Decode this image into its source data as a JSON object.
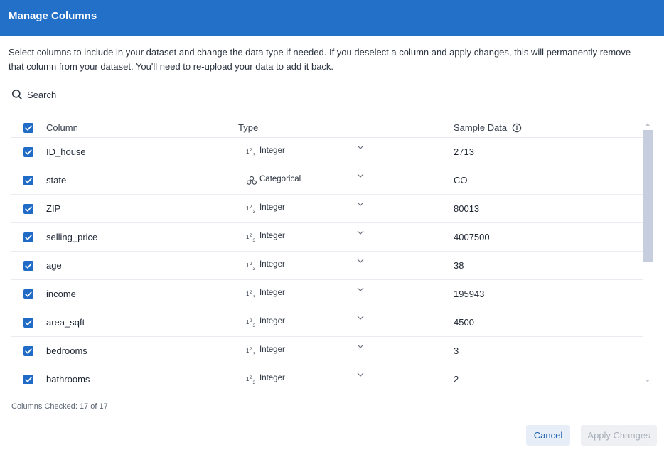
{
  "header": {
    "title": "Manage Columns"
  },
  "description": "Select columns to include in your dataset and change the data type if needed. If you deselect a column and apply changes, this will permanently remove that column from your dataset. You'll need to re-upload your data to add it back.",
  "search": {
    "label": "Search",
    "icon": "search-icon"
  },
  "table": {
    "headers": {
      "column": "Column",
      "type": "Type",
      "sample": "Sample Data"
    },
    "rows": [
      {
        "name": "ID_house",
        "type": "Integer",
        "type_icon": "integer",
        "sample": "2713",
        "checked": true
      },
      {
        "name": "state",
        "type": "Categorical",
        "type_icon": "categorical",
        "sample": "CO",
        "checked": true
      },
      {
        "name": "ZIP",
        "type": "Integer",
        "type_icon": "integer",
        "sample": "80013",
        "checked": true
      },
      {
        "name": "selling_price",
        "type": "Integer",
        "type_icon": "integer",
        "sample": "4007500",
        "checked": true
      },
      {
        "name": "age",
        "type": "Integer",
        "type_icon": "integer",
        "sample": "38",
        "checked": true
      },
      {
        "name": "income",
        "type": "Integer",
        "type_icon": "integer",
        "sample": "195943",
        "checked": true
      },
      {
        "name": "area_sqft",
        "type": "Integer",
        "type_icon": "integer",
        "sample": "4500",
        "checked": true
      },
      {
        "name": "bedrooms",
        "type": "Integer",
        "type_icon": "integer",
        "sample": "3",
        "checked": true
      },
      {
        "name": "bathrooms",
        "type": "Integer",
        "type_icon": "integer",
        "sample": "2",
        "checked": true
      }
    ]
  },
  "footer": {
    "checked_count": "Columns Checked: 17 of 17",
    "cancel_label": "Cancel",
    "apply_label": "Apply Changes"
  },
  "colors": {
    "header_bg": "#2270c8",
    "checkbox": "#1f6bc5",
    "cancel_bg": "#e7eef7",
    "apply_disabled_bg": "#eef0f3"
  }
}
